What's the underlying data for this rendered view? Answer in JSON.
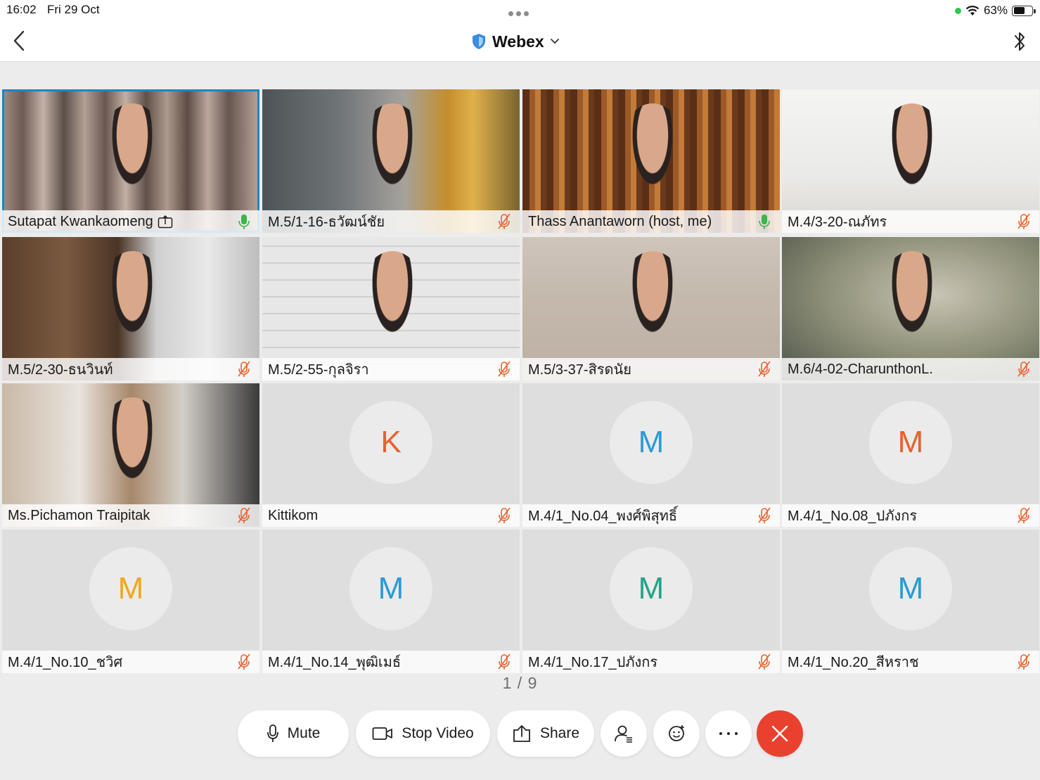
{
  "status_bar": {
    "time": "16:02",
    "date": "Fri 29 Oct",
    "battery": "63%",
    "battery_fraction": 0.63
  },
  "nav": {
    "title": "Webex",
    "back_icon": "chevron-left-icon",
    "right_icon": "bluetooth-icon"
  },
  "participants": [
    {
      "name": "Sutapat Kwankaomeng",
      "mic": "on",
      "sharing": true,
      "video": "v-curtain",
      "active": true
    },
    {
      "name": "M.5/1-16-ธวัฒน์ชัย",
      "mic": "muted",
      "video": "v-room1"
    },
    {
      "name": "Thass Anantaworn (host, me)",
      "mic": "on",
      "video": "v-library"
    },
    {
      "name": "M.4/3-20-ณภัทร",
      "mic": "muted",
      "video": "v-wall"
    },
    {
      "name": "M.5/2-30-ธนวินท์",
      "mic": "muted",
      "video": "v-wood"
    },
    {
      "name": "M.5/2-55-กุลจิรา",
      "mic": "muted",
      "video": "v-brick"
    },
    {
      "name": "M.5/3-37-สิรดนัย",
      "mic": "muted",
      "video": "v-beige"
    },
    {
      "name": "M.6/4-02-CharunthonL.",
      "mic": "muted",
      "video": "v-blur"
    },
    {
      "name": "Ms.Pichamon Traipitak",
      "mic": "muted",
      "video": "v-office"
    },
    {
      "name": "Kittikom",
      "mic": "muted",
      "initial": "K",
      "initial_color": "#e8612c"
    },
    {
      "name": "M.4/1_No.04_พงศ์พิสุทธิ์",
      "mic": "muted",
      "initial": "M",
      "initial_color": "#2a9bd6"
    },
    {
      "name": "M.4/1_No.08_ปภังกร",
      "mic": "muted",
      "initial": "M",
      "initial_color": "#e8612c"
    },
    {
      "name": "M.4/1_No.10_ชวิศ",
      "mic": "muted",
      "initial": "M",
      "initial_color": "#f0a81c"
    },
    {
      "name": "M.4/1_No.14_พุฒิเมธ์",
      "mic": "muted",
      "initial": "M",
      "initial_color": "#2a9bd6"
    },
    {
      "name": "M.4/1_No.17_ปภังกร",
      "mic": "muted",
      "initial": "M",
      "initial_color": "#21a589"
    },
    {
      "name": "M.4/1_No.20_สีหราช",
      "mic": "muted",
      "initial": "M",
      "initial_color": "#2a9bd6"
    }
  ],
  "page_indicator": "1 / 9",
  "controls": {
    "mute": "Mute",
    "stop_video": "Stop Video",
    "share": "Share"
  },
  "colors": {
    "active_border": "#1b86c7",
    "mic_on": "#3bb54a",
    "mic_muted": "#e8612c",
    "end_call": "#e8422f"
  }
}
